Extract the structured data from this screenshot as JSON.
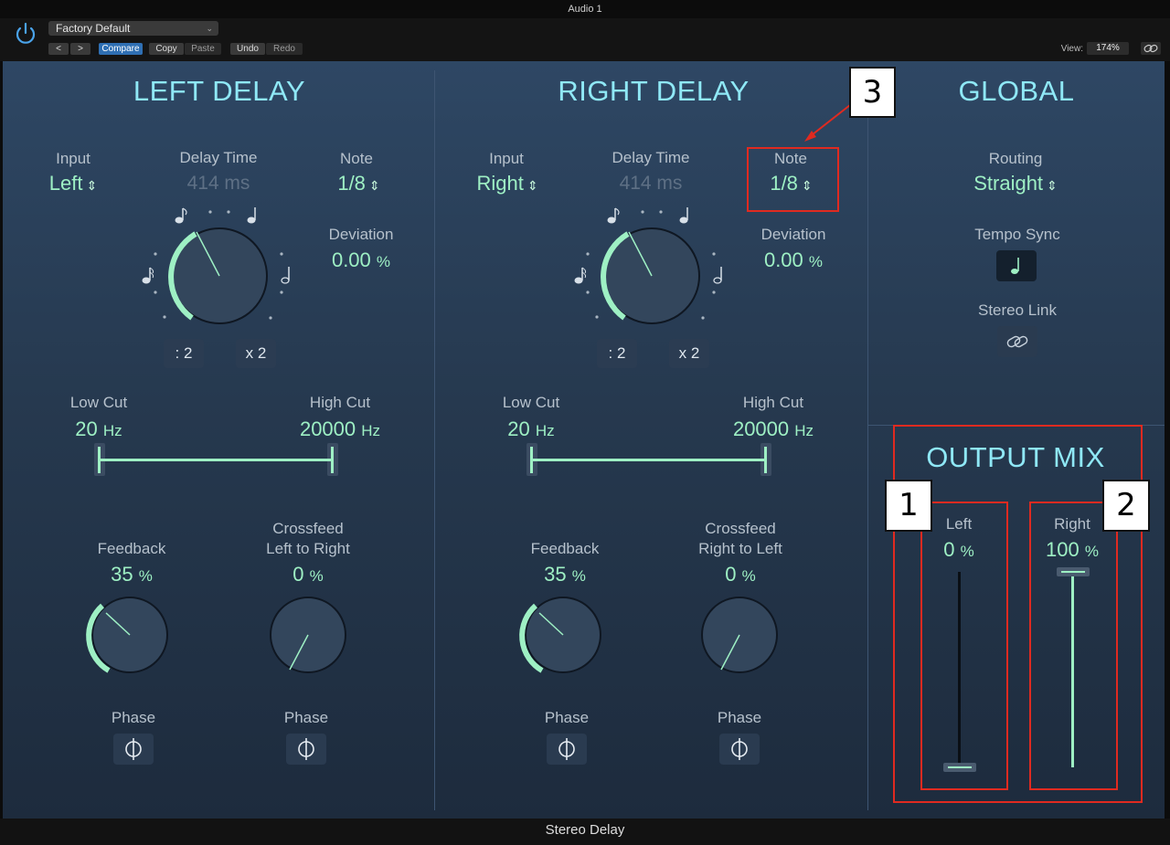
{
  "window": {
    "title": "Audio 1",
    "footer": "Stereo Delay"
  },
  "toolbar": {
    "preset": "Factory Default",
    "prev": "<",
    "next": ">",
    "compare": "Compare",
    "copy": "Copy",
    "paste": "Paste",
    "undo": "Undo",
    "redo": "Redo",
    "view_label": "View:",
    "zoom": "174%"
  },
  "left_delay": {
    "title": "LEFT DELAY",
    "input_label": "Input",
    "input_value": "Left",
    "delay_time_label": "Delay Time",
    "delay_time_value": "414 ms",
    "note_label": "Note",
    "note_value": "1/8",
    "deviation_label": "Deviation",
    "deviation_value": "0.00",
    "deviation_unit": "%",
    "half_btn": ": 2",
    "double_btn": "x 2",
    "low_cut_label": "Low Cut",
    "low_cut_value": "20",
    "low_cut_unit": "Hz",
    "high_cut_label": "High Cut",
    "high_cut_value": "20000",
    "high_cut_unit": "Hz",
    "feedback_label": "Feedback",
    "feedback_value": "35",
    "feedback_unit": "%",
    "crossfeed_label": "Crossfeed",
    "crossfeed_sub": "Left to Right",
    "crossfeed_value": "0",
    "crossfeed_unit": "%",
    "phase_label_1": "Phase",
    "phase_label_2": "Phase"
  },
  "right_delay": {
    "title": "RIGHT DELAY",
    "input_label": "Input",
    "input_value": "Right",
    "delay_time_label": "Delay Time",
    "delay_time_value": "414 ms",
    "note_label": "Note",
    "note_value": "1/8",
    "deviation_label": "Deviation",
    "deviation_value": "0.00",
    "deviation_unit": "%",
    "half_btn": ": 2",
    "double_btn": "x 2",
    "low_cut_label": "Low Cut",
    "low_cut_value": "20",
    "low_cut_unit": "Hz",
    "high_cut_label": "High Cut",
    "high_cut_value": "20000",
    "high_cut_unit": "Hz",
    "feedback_label": "Feedback",
    "feedback_value": "35",
    "feedback_unit": "%",
    "crossfeed_label": "Crossfeed",
    "crossfeed_sub": "Right to Left",
    "crossfeed_value": "0",
    "crossfeed_unit": "%",
    "phase_label_1": "Phase",
    "phase_label_2": "Phase"
  },
  "global": {
    "title": "GLOBAL",
    "routing_label": "Routing",
    "routing_value": "Straight",
    "tempo_sync_label": "Tempo Sync",
    "stereo_link_label": "Stereo Link"
  },
  "output_mix": {
    "title": "OUTPUT MIX",
    "left_label": "Left",
    "left_value": "0",
    "left_unit": "%",
    "left_level": 0,
    "right_label": "Right",
    "right_value": "100",
    "right_unit": "%",
    "right_level": 1
  },
  "annotations": {
    "n1": "1",
    "n2": "2",
    "n3": "3"
  },
  "colors": {
    "accent": "#9ef0c4",
    "title": "#8fe8f6",
    "annotation": "#e02a20"
  },
  "icons": [
    "power-icon",
    "link-icon",
    "note-icon",
    "phase-icon",
    "chain-link-icon"
  ]
}
